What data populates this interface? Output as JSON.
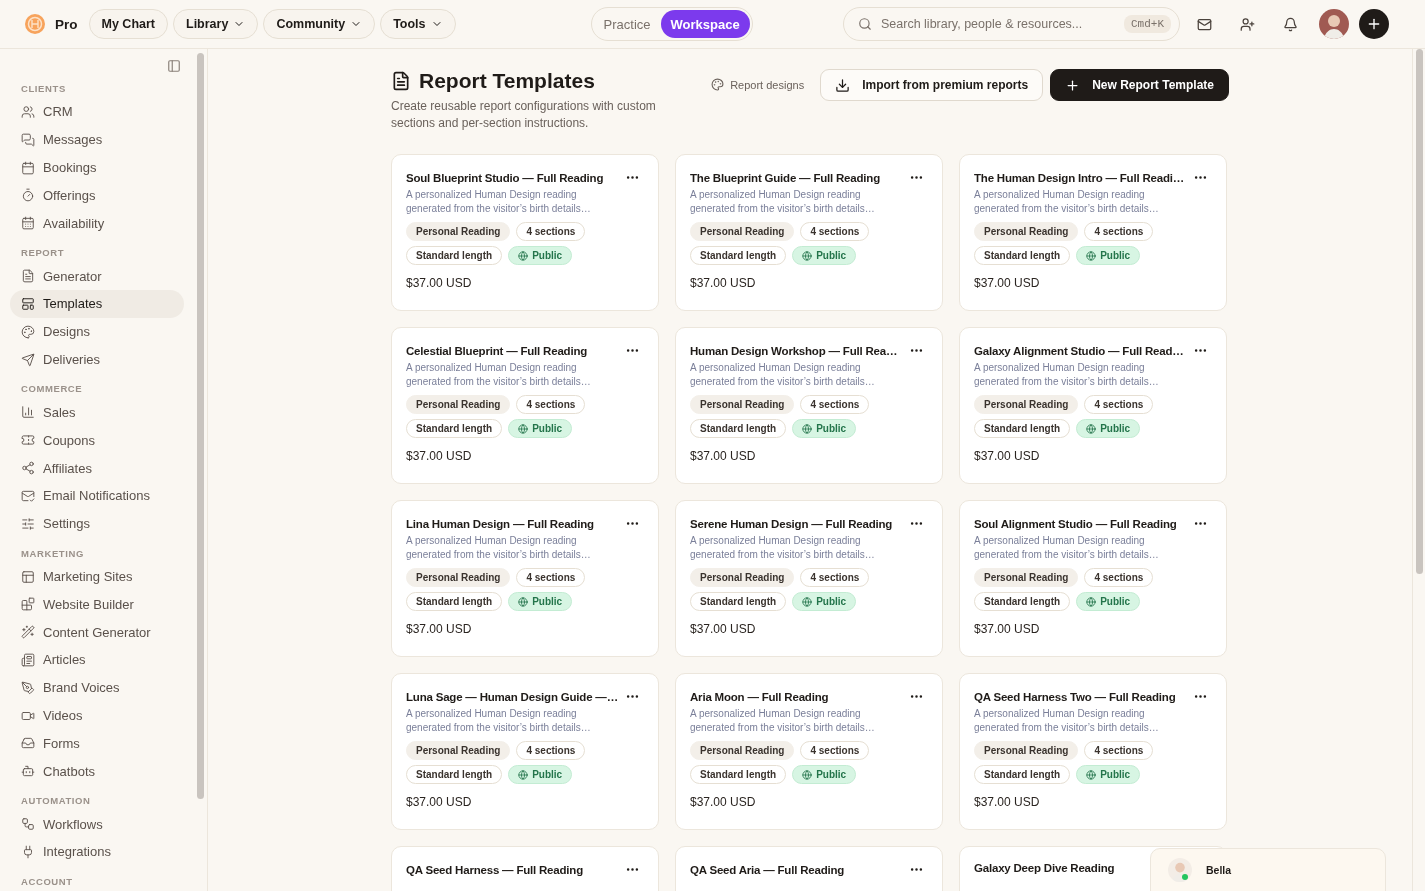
{
  "topbar": {
    "brand": "Pro",
    "nav": [
      {
        "label": "My Chart",
        "dropdown": false
      },
      {
        "label": "Library",
        "dropdown": true
      },
      {
        "label": "Community",
        "dropdown": true
      },
      {
        "label": "Tools",
        "dropdown": true
      }
    ],
    "modes": [
      {
        "label": "Practice",
        "selected": false
      },
      {
        "label": "Workspace",
        "selected": true
      }
    ],
    "search": {
      "placeholder": "Search library, people & resources...",
      "shortcut": "Cmd+K"
    }
  },
  "sidebar": {
    "sections": [
      {
        "heading": "CLIENTS",
        "items": [
          {
            "label": "CRM",
            "selected": false
          },
          {
            "label": "Messages",
            "selected": false
          },
          {
            "label": "Bookings",
            "selected": false
          },
          {
            "label": "Offerings",
            "selected": false
          },
          {
            "label": "Availability",
            "selected": false
          }
        ]
      },
      {
        "heading": "REPORT",
        "items": [
          {
            "label": "Generator",
            "selected": false
          },
          {
            "label": "Templates",
            "selected": true
          },
          {
            "label": "Designs",
            "selected": false
          },
          {
            "label": "Deliveries",
            "selected": false
          }
        ]
      },
      {
        "heading": "COMMERCE",
        "items": [
          {
            "label": "Sales",
            "selected": false
          },
          {
            "label": "Coupons",
            "selected": false
          },
          {
            "label": "Affiliates",
            "selected": false
          },
          {
            "label": "Email Notifications",
            "selected": false
          },
          {
            "label": "Settings",
            "selected": false
          }
        ]
      },
      {
        "heading": "MARKETING",
        "items": [
          {
            "label": "Marketing Sites",
            "selected": false
          },
          {
            "label": "Website Builder",
            "selected": false
          },
          {
            "label": "Content Generator",
            "selected": false
          },
          {
            "label": "Articles",
            "selected": false
          },
          {
            "label": "Brand Voices",
            "selected": false
          },
          {
            "label": "Videos",
            "selected": false
          },
          {
            "label": "Forms",
            "selected": false
          },
          {
            "label": "Chatbots",
            "selected": false
          }
        ]
      },
      {
        "heading": "AUTOMATION",
        "items": [
          {
            "label": "Workflows",
            "selected": false
          },
          {
            "label": "Integrations",
            "selected": false
          }
        ]
      },
      {
        "heading": "ACCOUNT"
      }
    ]
  },
  "header": {
    "title": "Report Templates",
    "subtitle": "Create reusable report configurations with custom sections and per-section instructions.",
    "designs_link": "Report designs",
    "import_button": "Import from premium reports",
    "new_button": "New Report Template"
  },
  "cards": [
    {
      "title": "Soul Blueprint Studio — Full Reading",
      "description": "A personalized Human Design reading generated from the visitor’s birth details…",
      "tags": [
        {
          "kind": "category",
          "label": "Personal Reading"
        },
        {
          "kind": "count",
          "label": "4 sections"
        },
        {
          "kind": "length",
          "label": "Standard length"
        },
        {
          "kind": "visibility",
          "label": "Public"
        }
      ],
      "price": "$37.00 USD"
    },
    {
      "title": "The Blueprint Guide — Full Reading",
      "description": "A personalized Human Design reading generated from the visitor’s birth details…",
      "tags": [
        {
          "kind": "category",
          "label": "Personal Reading"
        },
        {
          "kind": "count",
          "label": "4 sections"
        },
        {
          "kind": "length",
          "label": "Standard length"
        },
        {
          "kind": "visibility",
          "label": "Public"
        }
      ],
      "price": "$37.00 USD"
    },
    {
      "title": "The Human Design Intro — Full Readi…",
      "description": "A personalized Human Design reading generated from the visitor’s birth details…",
      "tags": [
        {
          "kind": "category",
          "label": "Personal Reading"
        },
        {
          "kind": "count",
          "label": "4 sections"
        },
        {
          "kind": "length",
          "label": "Standard length"
        },
        {
          "kind": "visibility",
          "label": "Public"
        }
      ],
      "price": "$37.00 USD"
    },
    {
      "title": "Celestial Blueprint — Full Reading",
      "description": "A personalized Human Design reading generated from the visitor’s birth details…",
      "tags": [
        {
          "kind": "category",
          "label": "Personal Reading"
        },
        {
          "kind": "count",
          "label": "4 sections"
        },
        {
          "kind": "length",
          "label": "Standard length"
        },
        {
          "kind": "visibility",
          "label": "Public"
        }
      ],
      "price": "$37.00 USD"
    },
    {
      "title": "Human Design Workshop — Full Rea…",
      "description": "A personalized Human Design reading generated from the visitor’s birth details…",
      "tags": [
        {
          "kind": "category",
          "label": "Personal Reading"
        },
        {
          "kind": "count",
          "label": "4 sections"
        },
        {
          "kind": "length",
          "label": "Standard length"
        },
        {
          "kind": "visibility",
          "label": "Public"
        }
      ],
      "price": "$37.00 USD"
    },
    {
      "title": "Galaxy Alignment Studio — Full Read…",
      "description": "A personalized Human Design reading generated from the visitor’s birth details…",
      "tags": [
        {
          "kind": "category",
          "label": "Personal Reading"
        },
        {
          "kind": "count",
          "label": "4 sections"
        },
        {
          "kind": "length",
          "label": "Standard length"
        },
        {
          "kind": "visibility",
          "label": "Public"
        }
      ],
      "price": "$37.00 USD"
    },
    {
      "title": "Lina Human Design — Full Reading",
      "description": "A personalized Human Design reading generated from the visitor’s birth details…",
      "tags": [
        {
          "kind": "category",
          "label": "Personal Reading"
        },
        {
          "kind": "count",
          "label": "4 sections"
        },
        {
          "kind": "length",
          "label": "Standard length"
        },
        {
          "kind": "visibility",
          "label": "Public"
        }
      ],
      "price": "$37.00 USD"
    },
    {
      "title": "Serene Human Design — Full Reading",
      "description": "A personalized Human Design reading generated from the visitor’s birth details…",
      "tags": [
        {
          "kind": "category",
          "label": "Personal Reading"
        },
        {
          "kind": "count",
          "label": "4 sections"
        },
        {
          "kind": "length",
          "label": "Standard length"
        },
        {
          "kind": "visibility",
          "label": "Public"
        }
      ],
      "price": "$37.00 USD"
    },
    {
      "title": "Soul Alignment Studio — Full Reading",
      "description": "A personalized Human Design reading generated from the visitor’s birth details…",
      "tags": [
        {
          "kind": "category",
          "label": "Personal Reading"
        },
        {
          "kind": "count",
          "label": "4 sections"
        },
        {
          "kind": "length",
          "label": "Standard length"
        },
        {
          "kind": "visibility",
          "label": "Public"
        }
      ],
      "price": "$37.00 USD"
    },
    {
      "title": "Luna Sage — Human Design Guide —…",
      "description": "A personalized Human Design reading generated from the visitor’s birth details…",
      "tags": [
        {
          "kind": "category",
          "label": "Personal Reading"
        },
        {
          "kind": "count",
          "label": "4 sections"
        },
        {
          "kind": "length",
          "label": "Standard length"
        },
        {
          "kind": "visibility",
          "label": "Public"
        }
      ],
      "price": "$37.00 USD"
    },
    {
      "title": "Aria Moon — Full Reading",
      "description": "A personalized Human Design reading generated from the visitor’s birth details…",
      "tags": [
        {
          "kind": "category",
          "label": "Personal Reading"
        },
        {
          "kind": "count",
          "label": "4 sections"
        },
        {
          "kind": "length",
          "label": "Standard length"
        },
        {
          "kind": "visibility",
          "label": "Public"
        }
      ],
      "price": "$37.00 USD"
    },
    {
      "title": "QA Seed Harness Two — Full Reading",
      "description": "A personalized Human Design reading generated from the visitor’s birth details…",
      "tags": [
        {
          "kind": "category",
          "label": "Personal Reading"
        },
        {
          "kind": "count",
          "label": "4 sections"
        },
        {
          "kind": "length",
          "label": "Standard length"
        },
        {
          "kind": "visibility",
          "label": "Public"
        }
      ],
      "price": "$37.00 USD"
    },
    {
      "title": "QA Seed Harness — Full Reading",
      "menu": true
    },
    {
      "title": "QA Seed Aria — Full Reading",
      "menu": true
    },
    {
      "title": "Galaxy Deep Dive Reading",
      "menu": false
    }
  ],
  "chat": {
    "name": "Bella",
    "online": true
  }
}
